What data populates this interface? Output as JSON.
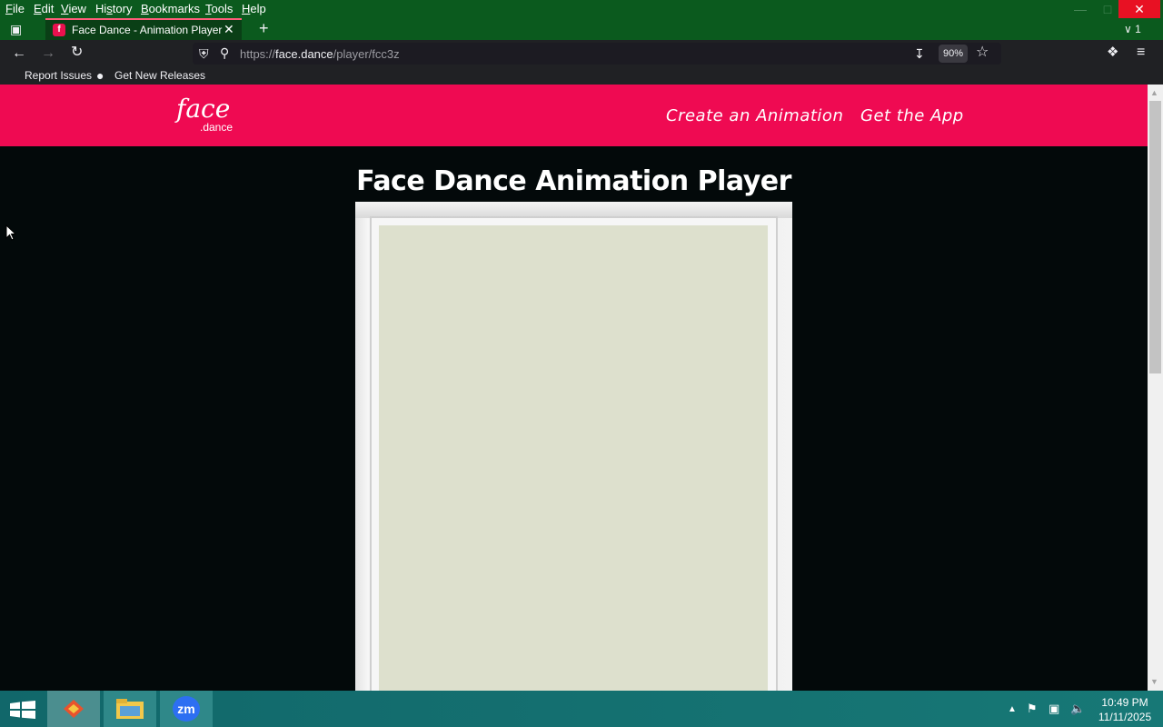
{
  "menubar": {
    "items": [
      {
        "pre": "",
        "key": "F",
        "post": "ile"
      },
      {
        "pre": "",
        "key": "E",
        "post": "dit"
      },
      {
        "pre": "",
        "key": "V",
        "post": "iew"
      },
      {
        "pre": "Hi",
        "key": "s",
        "post": "tory"
      },
      {
        "pre": "",
        "key": "B",
        "post": "ookmarks"
      },
      {
        "pre": "",
        "key": "T",
        "post": "ools"
      },
      {
        "pre": "",
        "key": "H",
        "post": "elp"
      }
    ]
  },
  "tabs": {
    "active_title": "Face Dance - Animation Player",
    "list_all_count": "1"
  },
  "navbar": {
    "url_prefix": "https://",
    "url_host": "face.dance",
    "url_path": "/player/fcc3z",
    "zoom": "90%"
  },
  "bookmarks": {
    "items": [
      "Report Issues",
      "Get New Releases"
    ]
  },
  "site": {
    "logo_main": "face",
    "logo_sub": ".dance",
    "nav": [
      "Create an Animation",
      "Get the App"
    ],
    "page_title": "Face Dance Animation Player"
  },
  "taskbar": {
    "time": "10:49 PM",
    "date": "11/11/2025"
  },
  "colors": {
    "brand": "#ef0a52",
    "page_bg": "#03090a",
    "canvas": "#dde0cd",
    "titlebar": "#0b5a1e"
  }
}
